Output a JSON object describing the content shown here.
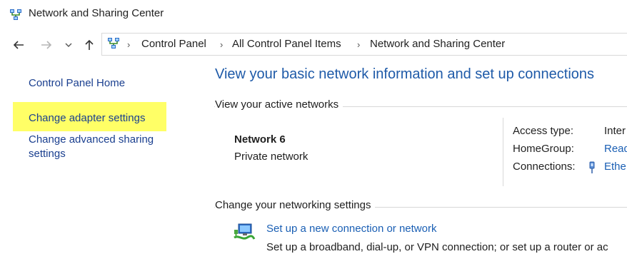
{
  "window": {
    "title": "Network and Sharing Center"
  },
  "breadcrumb": {
    "items": [
      "Control Panel",
      "All Control Panel Items",
      "Network and Sharing Center"
    ]
  },
  "sidebar": {
    "items": [
      {
        "label": "Control Panel Home"
      },
      {
        "label": "Change adapter settings",
        "highlighted": true
      },
      {
        "label_line1": "Change advanced sharing",
        "label_line2": "settings"
      }
    ],
    "highlight_color": "#ffff66"
  },
  "main": {
    "heading": "View your basic network information and set up connections",
    "active_networks_label": "View your active networks",
    "network": {
      "name": "Network  6",
      "type": "Private network"
    },
    "properties": [
      {
        "label": "Access type:",
        "value": "Inter"
      },
      {
        "label": "HomeGroup:",
        "value": "Read"
      },
      {
        "label": "Connections:",
        "value": "Ethe"
      }
    ],
    "change_settings_label": "Change your networking settings",
    "setup": {
      "link": "Set up a new connection or network",
      "description": "Set up a broadband, dial-up, or VPN connection; or set up a router or ac"
    }
  },
  "colors": {
    "heading": "#1e5aa8",
    "link": "#1a5fb4",
    "sidebar_link": "#1a3f8f"
  }
}
